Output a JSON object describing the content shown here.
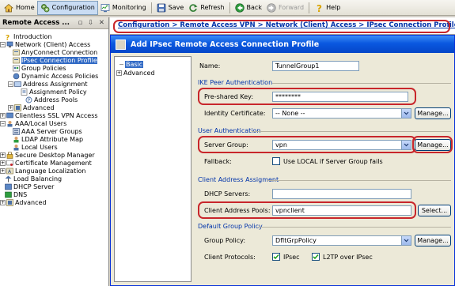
{
  "toolbar": {
    "home": "Home",
    "configuration": "Configuration",
    "monitoring": "Monitoring",
    "save": "Save",
    "refresh": "Refresh",
    "back": "Back",
    "forward": "Forward",
    "help": "Help"
  },
  "nav": {
    "title": "Remote Access ...",
    "controls": "▫ ⇩ ✕",
    "items": [
      {
        "label": "Introduction"
      },
      {
        "label": "Network (Client) Access"
      },
      {
        "label": "AnyConnect Connection"
      },
      {
        "label": "IPsec Connection Profile"
      },
      {
        "label": "Group Policies"
      },
      {
        "label": "Dynamic Access Policies"
      },
      {
        "label": "Address Assignment"
      },
      {
        "label": "Assignment Policy"
      },
      {
        "label": "Address Pools"
      },
      {
        "label": "Advanced"
      },
      {
        "label": "Clientless SSL VPN Access"
      },
      {
        "label": "AAA/Local Users"
      },
      {
        "label": "AAA Server Groups"
      },
      {
        "label": "LDAP Attribute Map"
      },
      {
        "label": "Local Users"
      },
      {
        "label": "Secure Desktop Manager"
      },
      {
        "label": "Certificate Management"
      },
      {
        "label": "Language Localization"
      },
      {
        "label": "Load Balancing"
      },
      {
        "label": "DHCP Server"
      },
      {
        "label": "DNS"
      },
      {
        "label": "Advanced"
      }
    ]
  },
  "breadcrumb": "Configuration > Remote Access VPN > Network (Client) Access > IPsec Connection Profiles",
  "dialog": {
    "title": "Add IPsec Remote Access Connection Profile",
    "tree": {
      "basic": "Basic",
      "advanced": "Advanced"
    },
    "name_label": "Name:",
    "name_value": "TunnelGroup1",
    "ike_section": "IKE Peer Authentication",
    "psk_label": "Pre-shared Key:",
    "psk_value": "********",
    "idcert_label": "Identity Certificate:",
    "idcert_value": "-- None --",
    "manage": "Manage...",
    "user_auth_section": "User Authentication",
    "server_group_label": "Server Group:",
    "server_group_value": "vpn",
    "fallback_label": "Fallback:",
    "fallback_checkbox": "Use LOCAL if Server Group fails",
    "client_addr_section": "Client Address Assigment",
    "dhcp_label": "DHCP Servers:",
    "dhcp_value": "",
    "pools_label": "Client Address Pools:",
    "pools_value": "vpnclient",
    "select": "Select...",
    "default_group_section": "Default Group Policy",
    "group_policy_label": "Group Policy:",
    "group_policy_value": "DfltGrpPolicy",
    "protocols_label": "Client Protocols:",
    "protocol_ipsec": "IPsec",
    "protocol_l2tp": "L2TP over IPsec"
  }
}
